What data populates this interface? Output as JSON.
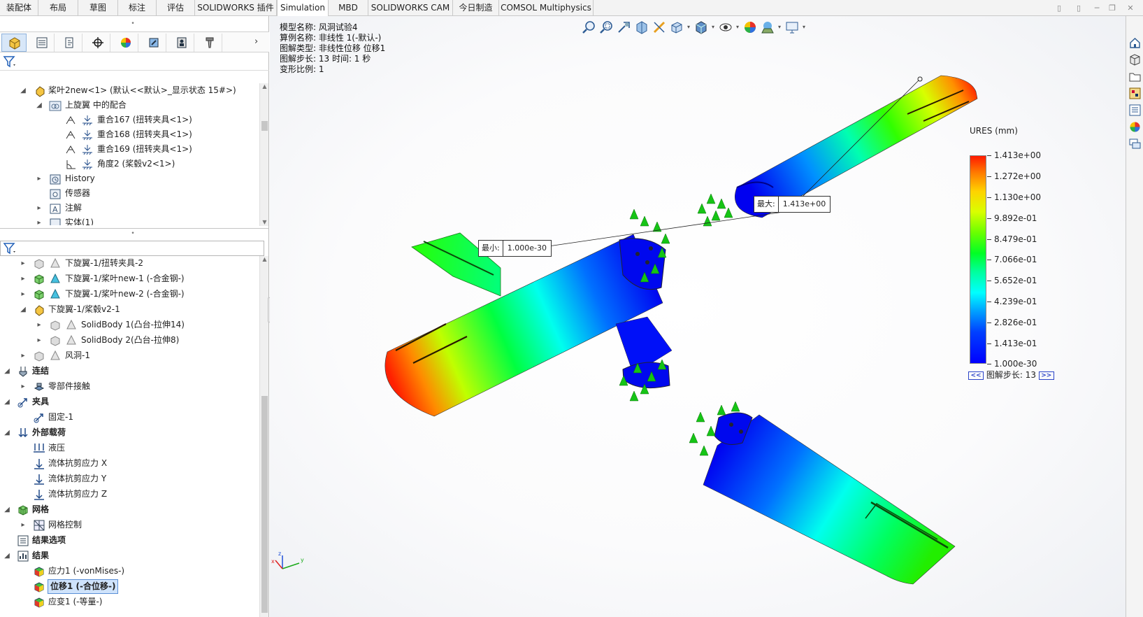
{
  "tabs": [
    {
      "label": "装配体"
    },
    {
      "label": "布局"
    },
    {
      "label": "草图"
    },
    {
      "label": "标注"
    },
    {
      "label": "评估"
    },
    {
      "label": "SOLIDWORKS 插件"
    },
    {
      "label": "Simulation"
    },
    {
      "label": "MBD"
    },
    {
      "label": "SOLIDWORKS CAM"
    },
    {
      "label": "今日制造"
    },
    {
      "label": "COMSOL Multiphysics"
    }
  ],
  "active_tab": "Simulation",
  "feature_tree_top": [
    {
      "label": "桨叶2new<1> (默认<<默认>_显示状态 15#>)",
      "icon": "part-assembly-icon"
    },
    {
      "label": "上旋翼 中的配合",
      "icon": "mates-folder-icon"
    },
    {
      "label": "重合167 (扭转夹具<1>)",
      "icon": "coincident-mate-icon"
    },
    {
      "label": "重合168 (扭转夹具<1>)",
      "icon": "coincident-mate-icon"
    },
    {
      "label": "重合169 (扭转夹具<1>)",
      "icon": "coincident-mate-icon"
    },
    {
      "label": "角度2 (桨毂v2<1>)",
      "icon": "angle-mate-icon"
    },
    {
      "label": "History",
      "icon": "history-icon"
    },
    {
      "label": "传感器",
      "icon": "sensor-icon"
    },
    {
      "label": "注解",
      "icon": "annotation-icon"
    },
    {
      "label": "实体(1)",
      "icon": "solid-bodies-icon"
    }
  ],
  "study_tree": [
    {
      "label": "下旋翼-1/扭转夹具-2"
    },
    {
      "label": "下旋翼-1/桨叶new-1 (-合金钢-)"
    },
    {
      "label": "下旋翼-1/桨叶new-2 (-合金钢-)"
    },
    {
      "label": "下旋翼-1/桨毂v2-1"
    },
    {
      "label": "SolidBody 1(凸台-拉伸14)"
    },
    {
      "label": "SolidBody 2(凸台-拉伸8)"
    },
    {
      "label": "风洞-1"
    },
    {
      "label": "连结"
    },
    {
      "label": "零部件接触"
    },
    {
      "label": "夹具"
    },
    {
      "label": "固定-1"
    },
    {
      "label": "外部载荷"
    },
    {
      "label": "液压"
    },
    {
      "label": "流体抗剪应力 X"
    },
    {
      "label": "流体抗剪应力 Y"
    },
    {
      "label": "流体抗剪应力 Z"
    },
    {
      "label": "网格"
    },
    {
      "label": "网格控制"
    },
    {
      "label": "结果选项"
    },
    {
      "label": "结果"
    },
    {
      "label": "应力1 (-vonMises-)"
    },
    {
      "label": "位移1 (-合位移-)"
    },
    {
      "label": "应变1 (-等量-)"
    }
  ],
  "selected_result": "位移1 (-合位移-)",
  "study_info": {
    "model": "模型名称: 风洞试验4",
    "study": "算例名称: 非线性 1(-默认-)",
    "plot_type": "图解类型: 非线性位移 位移1",
    "step": "图解步长: 13   时间:  1 秒",
    "scale": "变形比例: 1"
  },
  "legend": {
    "title": "URES (mm)",
    "values": [
      "1.413e+00",
      "1.272e+00",
      "1.130e+00",
      "9.892e-01",
      "8.479e-01",
      "7.066e-01",
      "5.652e-01",
      "4.239e-01",
      "2.826e-01",
      "1.413e-01",
      "1.000e-30"
    ],
    "step_label": "图解步长: 13",
    "prev": "<<",
    "next": ">>"
  },
  "callouts": {
    "max_key": "最大:",
    "max_val": "1.413e+00",
    "min_key": "最小:",
    "min_val": "1.000e-30"
  },
  "triad": {
    "x": "x",
    "y": "y",
    "z": "z"
  },
  "colors": {
    "selection": "#cfe3fb",
    "legend_max": "#ff1a00",
    "legend_min": "#0000ff",
    "fixture": "#1ec81e"
  }
}
